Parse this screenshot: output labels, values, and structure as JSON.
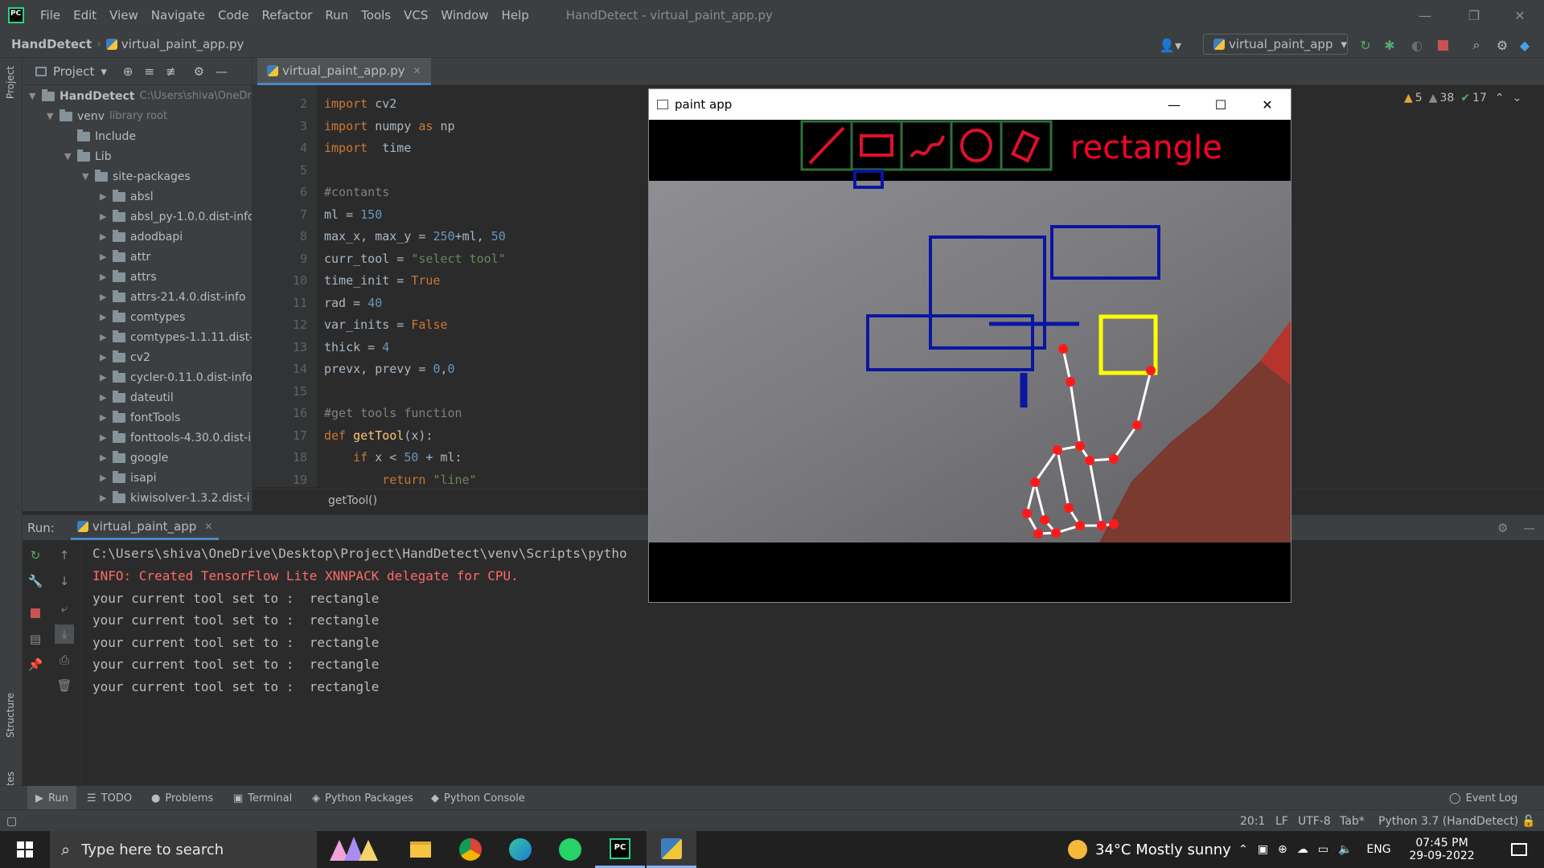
{
  "menu": {
    "items": [
      "File",
      "Edit",
      "View",
      "Navigate",
      "Code",
      "Refactor",
      "Run",
      "Tools",
      "VCS",
      "Window",
      "Help"
    ],
    "title": "HandDetect - virtual_paint_app.py"
  },
  "nav": {
    "project": "HandDetect",
    "file": "virtual_paint_app.py",
    "run_config": "virtual_paint_app"
  },
  "project_panel": {
    "header": "Project",
    "rows": [
      {
        "label": "HandDetect",
        "extra": "C:\\Users\\shiva\\OneDr"
      },
      {
        "label": "venv",
        "extra": "library root"
      },
      {
        "label": "Include"
      },
      {
        "label": "Lib"
      },
      {
        "label": "site-packages"
      },
      {
        "label": "absl"
      },
      {
        "label": "absl_py-1.0.0.dist-info"
      },
      {
        "label": "adodbapi"
      },
      {
        "label": "attr"
      },
      {
        "label": "attrs"
      },
      {
        "label": "attrs-21.4.0.dist-info"
      },
      {
        "label": "comtypes"
      },
      {
        "label": "comtypes-1.1.11.dist-"
      },
      {
        "label": "cv2"
      },
      {
        "label": "cycler-0.11.0.dist-info"
      },
      {
        "label": "dateutil"
      },
      {
        "label": "fontTools"
      },
      {
        "label": "fonttools-4.30.0.dist-i"
      },
      {
        "label": "google"
      },
      {
        "label": "isapi"
      },
      {
        "label": "kiwisolver-1.3.2.dist-i"
      }
    ]
  },
  "editor": {
    "tab": "virtual_paint_app.py",
    "inspection": {
      "warnings": "5",
      "weak": "38",
      "ok": "17"
    },
    "line_numbers": [
      "2",
      "3",
      "4",
      "5",
      "6",
      "7",
      "8",
      "9",
      "10",
      "11",
      "12",
      "13",
      "14",
      "15",
      "16",
      "17",
      "18",
      "19"
    ],
    "breadcrumb": "getTool()"
  },
  "run_panel": {
    "label": "Run:",
    "tab": "virtual_paint_app",
    "lines": [
      {
        "text": "C:\\Users\\shiva\\OneDrive\\Desktop\\Project\\HandDetect\\venv\\Scripts\\pytho",
        "color": "#bbbbbb"
      },
      {
        "text": "INFO: Created TensorFlow Lite XNNPACK delegate for CPU.",
        "color": "#ff6b68"
      },
      {
        "text": "your current tool set to :  rectangle",
        "color": "#bbbbbb"
      },
      {
        "text": "your current tool set to :  rectangle",
        "color": "#bbbbbb"
      },
      {
        "text": "your current tool set to :  rectangle",
        "color": "#bbbbbb"
      },
      {
        "text": "your current tool set to :  rectangle",
        "color": "#bbbbbb"
      },
      {
        "text": "your current tool set to :  rectangle",
        "color": "#bbbbbb"
      }
    ]
  },
  "bottom_tabs": [
    "Run",
    "TODO",
    "Problems",
    "Terminal",
    "Python Packages",
    "Python Console"
  ],
  "event_log": "Event Log",
  "status": {
    "pos": "20:1",
    "eol": "LF",
    "enc": "UTF-8",
    "indent": "Tab*",
    "interp": "Python 3.7 (HandDetect)"
  },
  "side_labels": {
    "project": "Project",
    "structure": "Structure",
    "favorites": "Favorites"
  },
  "paint_app": {
    "title": "paint app",
    "current_tool": "rectangle",
    "tool_icons": [
      "line-tool-icon",
      "rectangle-tool-icon",
      "draw-tool-icon",
      "circle-tool-icon",
      "erase-tool-icon"
    ]
  },
  "taskbar": {
    "search_placeholder": "Type here to search",
    "weather": "34°C  Mostly sunny",
    "lang": "ENG",
    "time": "07:45 PM",
    "date": "29-09-2022"
  },
  "colors": {
    "accent": "#4a88c7",
    "error": "#ff6b68",
    "tool_label": "#ff0028",
    "yellow_rect": "#ffff00",
    "blue_rect": "#0a16a0"
  }
}
